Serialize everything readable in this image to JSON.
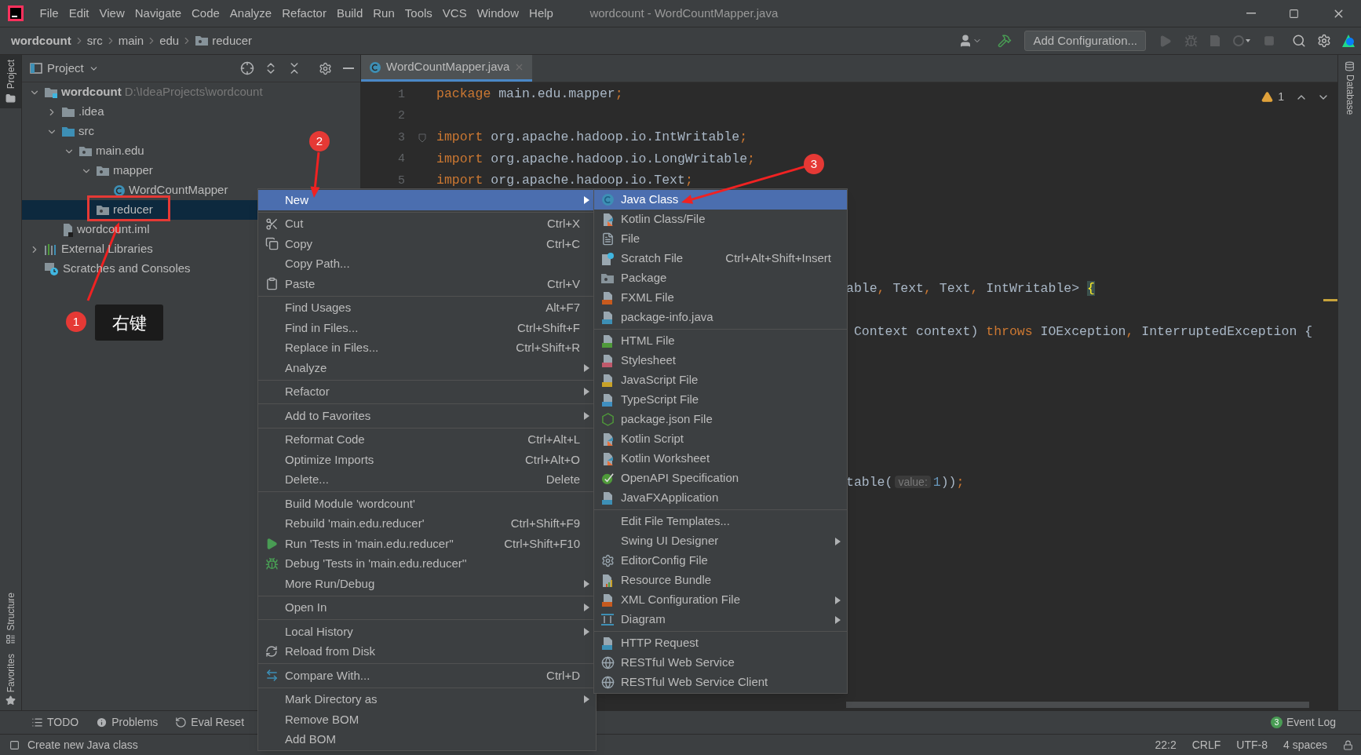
{
  "window": {
    "title": "wordcount - WordCountMapper.java",
    "menu": [
      "File",
      "Edit",
      "View",
      "Navigate",
      "Code",
      "Analyze",
      "Refactor",
      "Build",
      "Run",
      "Tools",
      "VCS",
      "Window",
      "Help"
    ]
  },
  "breadcrumbs": [
    {
      "label": "wordcount",
      "kind": "project"
    },
    {
      "label": "src",
      "kind": "dir"
    },
    {
      "label": "main",
      "kind": "dir"
    },
    {
      "label": "edu",
      "kind": "dir"
    },
    {
      "label": "reducer",
      "kind": "package"
    }
  ],
  "toolbar": {
    "run_config": "Add Configuration..."
  },
  "side_tabs": {
    "left_top": [
      {
        "label": "Project",
        "selected": true
      }
    ],
    "left_bottom": [
      {
        "label": "Structure",
        "selected": false
      },
      {
        "label": "Favorites",
        "selected": false
      }
    ],
    "right": [
      {
        "label": "Database",
        "selected": false
      }
    ]
  },
  "project": {
    "title": "Project",
    "tree": [
      {
        "label": "wordcount",
        "path": "D:\\IdeaProjects\\wordcount",
        "kind": "module",
        "expanded": true,
        "selected": false,
        "children": [
          {
            "label": ".idea",
            "kind": "folder",
            "expanded": false,
            "selected": false
          },
          {
            "label": "src",
            "kind": "source",
            "expanded": true,
            "selected": false,
            "children": [
              {
                "label": "main.edu",
                "kind": "package",
                "expanded": true,
                "selected": false,
                "children": [
                  {
                    "label": "mapper",
                    "kind": "package",
                    "expanded": true,
                    "selected": false,
                    "children": [
                      {
                        "label": "WordCountMapper",
                        "kind": "class",
                        "selected": false
                      }
                    ]
                  },
                  {
                    "label": "reducer",
                    "kind": "package",
                    "selected": true
                  }
                ]
              }
            ]
          },
          {
            "label": "wordcount.iml",
            "kind": "iml",
            "selected": false
          }
        ]
      },
      {
        "label": "External Libraries",
        "kind": "libraries",
        "expanded": false,
        "selected": false
      },
      {
        "label": "Scratches and Consoles",
        "kind": "scratches",
        "selected": false
      }
    ]
  },
  "editor": {
    "tabs": [
      {
        "label": "WordCountMapper.java",
        "selected": true
      }
    ],
    "warnings": "1",
    "lines": [
      {
        "kind": "numbered",
        "number": "1",
        "fold": false,
        "code": [
          {
            "kind": "keyword",
            "text": "package"
          },
          {
            "kind": "plain",
            "text": " main.edu.mapper"
          },
          {
            "kind": "keyword",
            "text": ";"
          }
        ]
      },
      {
        "kind": "numbered",
        "number": "2",
        "fold": false
      },
      {
        "kind": "numbered",
        "number": "3",
        "fold": true,
        "code": [
          {
            "kind": "keyword",
            "text": "import"
          },
          {
            "kind": "plain",
            "text": " org.apache.hadoop.io.IntWritable"
          },
          {
            "kind": "keyword",
            "text": ";"
          }
        ]
      },
      {
        "kind": "numbered",
        "number": "4",
        "fold": false,
        "code": [
          {
            "kind": "keyword",
            "text": "import"
          },
          {
            "kind": "plain",
            "text": " org.apache.hadoop.io.LongWritable"
          },
          {
            "kind": "keyword",
            "text": ";"
          }
        ]
      },
      {
        "kind": "numbered",
        "number": "5",
        "fold": false,
        "code": [
          {
            "kind": "keyword",
            "text": "import"
          },
          {
            "kind": "plain",
            "text": " org.apache.hadoop.io.Text"
          },
          {
            "kind": "keyword",
            "text": ";"
          }
        ]
      },
      {
        "kind": "covered"
      },
      {
        "kind": "covered"
      },
      {
        "kind": "covered"
      },
      {
        "kind": "covered"
      },
      {
        "kind": "clipped",
        "code": [
          {
            "kind": "plain",
            "text": "able"
          },
          {
            "kind": "keyword",
            "text": ","
          },
          {
            "kind": "plain",
            "text": " Text"
          },
          {
            "kind": "keyword",
            "text": ","
          },
          {
            "kind": "plain",
            "text": " Text"
          },
          {
            "kind": "keyword",
            "text": ","
          },
          {
            "kind": "plain",
            "text": " IntWritable> "
          },
          {
            "kind": "brace",
            "text": "{"
          }
        ]
      },
      {
        "kind": "covered"
      },
      {
        "kind": "clipped",
        "code": [
          {
            "kind": "plain",
            "text": " Context context) "
          },
          {
            "kind": "keyword",
            "text": "throws"
          },
          {
            "kind": "plain",
            "text": " IOException"
          },
          {
            "kind": "keyword",
            "text": ","
          },
          {
            "kind": "plain",
            "text": " InterruptedException {"
          }
        ]
      },
      {
        "kind": "covered"
      },
      {
        "kind": "covered"
      },
      {
        "kind": "covered"
      },
      {
        "kind": "covered"
      },
      {
        "kind": "covered"
      },
      {
        "kind": "covered"
      },
      {
        "kind": "clipped",
        "code": [
          {
            "kind": "plain",
            "text": "table("
          },
          {
            "kind": "hint",
            "text": "value:"
          },
          {
            "kind": "number",
            "text": "1"
          },
          {
            "kind": "plain",
            "text": "))"
          },
          {
            "kind": "keyword",
            "text": ";"
          }
        ]
      }
    ]
  },
  "context_menu": {
    "items": [
      {
        "kind": "plain",
        "label": "New",
        "submenu": true,
        "selected": true
      },
      {
        "kind": "separator"
      },
      {
        "kind": "cut",
        "label": "Cut",
        "shortcut": "Ctrl+X",
        "submenu": false,
        "selected": false
      },
      {
        "kind": "copy",
        "label": "Copy",
        "shortcut": "Ctrl+C",
        "submenu": false,
        "selected": false
      },
      {
        "kind": "plain",
        "label": "Copy Path...",
        "submenu": false,
        "selected": false
      },
      {
        "kind": "paste",
        "label": "Paste",
        "shortcut": "Ctrl+V",
        "submenu": false,
        "selected": false
      },
      {
        "kind": "separator"
      },
      {
        "kind": "plain",
        "label": "Find Usages",
        "shortcut": "Alt+F7",
        "submenu": false,
        "selected": false
      },
      {
        "kind": "plain",
        "label": "Find in Files...",
        "shortcut": "Ctrl+Shift+F",
        "submenu": false,
        "selected": false
      },
      {
        "kind": "plain",
        "label": "Replace in Files...",
        "shortcut": "Ctrl+Shift+R",
        "submenu": false,
        "selected": false
      },
      {
        "kind": "plain",
        "label": "Analyze",
        "submenu": true,
        "selected": false
      },
      {
        "kind": "separator"
      },
      {
        "kind": "plain",
        "label": "Refactor",
        "submenu": true,
        "selected": false
      },
      {
        "kind": "separator"
      },
      {
        "kind": "plain",
        "label": "Add to Favorites",
        "submenu": true,
        "selected": false
      },
      {
        "kind": "separator"
      },
      {
        "kind": "plain",
        "label": "Reformat Code",
        "shortcut": "Ctrl+Alt+L",
        "submenu": false,
        "selected": false
      },
      {
        "kind": "plain",
        "label": "Optimize Imports",
        "shortcut": "Ctrl+Alt+O",
        "submenu": false,
        "selected": false
      },
      {
        "kind": "plain",
        "label": "Delete...",
        "shortcut": "Delete",
        "submenu": false,
        "selected": false
      },
      {
        "kind": "separator"
      },
      {
        "kind": "plain",
        "label": "Build Module 'wordcount'",
        "submenu": false,
        "selected": false
      },
      {
        "kind": "plain",
        "label": "Rebuild 'main.edu.reducer'",
        "shortcut": "Ctrl+Shift+F9",
        "submenu": false,
        "selected": false
      },
      {
        "kind": "run",
        "label": "Run 'Tests in 'main.edu.reducer''",
        "shortcut": "Ctrl+Shift+F10",
        "submenu": false,
        "selected": false
      },
      {
        "kind": "debug",
        "label": "Debug 'Tests in 'main.edu.reducer''",
        "submenu": false,
        "selected": false
      },
      {
        "kind": "plain",
        "label": "More Run/Debug",
        "submenu": true,
        "selected": false
      },
      {
        "kind": "separator"
      },
      {
        "kind": "plain",
        "label": "Open In",
        "submenu": true,
        "selected": false
      },
      {
        "kind": "separator"
      },
      {
        "kind": "plain",
        "label": "Local History",
        "submenu": true,
        "selected": false
      },
      {
        "kind": "reload",
        "label": "Reload from Disk",
        "submenu": false,
        "selected": false
      },
      {
        "kind": "separator"
      },
      {
        "kind": "compare",
        "label": "Compare With...",
        "shortcut": "Ctrl+D",
        "submenu": false,
        "selected": false
      },
      {
        "kind": "separator"
      },
      {
        "kind": "plain",
        "label": "Mark Directory as",
        "submenu": true,
        "selected": false
      },
      {
        "kind": "plain",
        "label": "Remove BOM",
        "submenu": false,
        "selected": false
      },
      {
        "kind": "plain",
        "label": "Add BOM",
        "submenu": false,
        "selected": false
      }
    ]
  },
  "submenu": {
    "items": [
      {
        "kind": "java-class",
        "label": "Java Class",
        "submenu": false,
        "selected": true
      },
      {
        "kind": "kotlin",
        "label": "Kotlin Class/File",
        "submenu": false,
        "selected": false
      },
      {
        "kind": "file",
        "label": "File",
        "submenu": false,
        "selected": false
      },
      {
        "kind": "scratch",
        "label": "Scratch File",
        "shortcut": "Ctrl+Alt+Shift+Insert",
        "submenu": false,
        "selected": false
      },
      {
        "kind": "package",
        "label": "Package",
        "submenu": false,
        "selected": false
      },
      {
        "kind": "tagged-file",
        "color": "#c75a1e",
        "label": "FXML File",
        "submenu": false,
        "selected": false
      },
      {
        "kind": "tagged-file",
        "color": "#3d8fb5",
        "label": "package-info.java",
        "submenu": false,
        "selected": false
      },
      {
        "kind": "separator"
      },
      {
        "kind": "tagged-file",
        "color": "#4f9a3a",
        "label": "HTML File",
        "submenu": false,
        "selected": false
      },
      {
        "kind": "tagged-file",
        "color": "#c0596b",
        "label": "Stylesheet",
        "submenu": false,
        "selected": false
      },
      {
        "kind": "tagged-file",
        "color": "#c9a227",
        "label": "JavaScript File",
        "submenu": false,
        "selected": false
      },
      {
        "kind": "tagged-file",
        "color": "#3f8fc0",
        "label": "TypeScript File",
        "submenu": false,
        "selected": false
      },
      {
        "kind": "json",
        "label": "package.json File",
        "submenu": false,
        "selected": false
      },
      {
        "kind": "kotlin",
        "label": "Kotlin Script",
        "submenu": false,
        "selected": false
      },
      {
        "kind": "kotlin",
        "label": "Kotlin Worksheet",
        "submenu": false,
        "selected": false
      },
      {
        "kind": "openapi",
        "label": "OpenAPI Specification",
        "submenu": false,
        "selected": false
      },
      {
        "kind": "tagged-file",
        "color": "#3d8fb5",
        "label": "JavaFXApplication",
        "submenu": false,
        "selected": false
      },
      {
        "kind": "separator"
      },
      {
        "kind": "plain",
        "label": "Edit File Templates...",
        "submenu": false,
        "selected": false
      },
      {
        "kind": "plain",
        "label": "Swing UI Designer",
        "submenu": true,
        "selected": false
      },
      {
        "kind": "gear",
        "label": "EditorConfig File",
        "submenu": false,
        "selected": false
      },
      {
        "kind": "bundle",
        "label": "Resource Bundle",
        "submenu": false,
        "selected": false
      },
      {
        "kind": "tagged-file",
        "color": "#c75a1e",
        "label": "XML Configuration File",
        "submenu": true,
        "selected": false
      },
      {
        "kind": "diagram",
        "label": "Diagram",
        "submenu": true,
        "selected": false
      },
      {
        "kind": "separator"
      },
      {
        "kind": "tagged-file",
        "color": "#3d8fb5",
        "label": "HTTP Request",
        "submenu": false,
        "selected": false
      },
      {
        "kind": "globe",
        "label": "RESTful Web Service",
        "submenu": false,
        "selected": false
      },
      {
        "kind": "globe",
        "label": "RESTful Web Service Client",
        "submenu": false,
        "selected": false
      }
    ]
  },
  "annotations": {
    "badges": [
      "1",
      "2",
      "3"
    ],
    "callout": "右键"
  },
  "bottom_tools": [
    {
      "kind": "todo",
      "label": "TODO"
    },
    {
      "kind": "problems",
      "label": "Problems"
    },
    {
      "kind": "reset",
      "label": "Eval Reset"
    }
  ],
  "event_log": {
    "label": "Event Log",
    "count": "3"
  },
  "status_bar": {
    "message": "Create new Java class",
    "position": "22:2",
    "line_separator": "CRLF",
    "encoding": "UTF-8",
    "indent": "4 spaces"
  }
}
